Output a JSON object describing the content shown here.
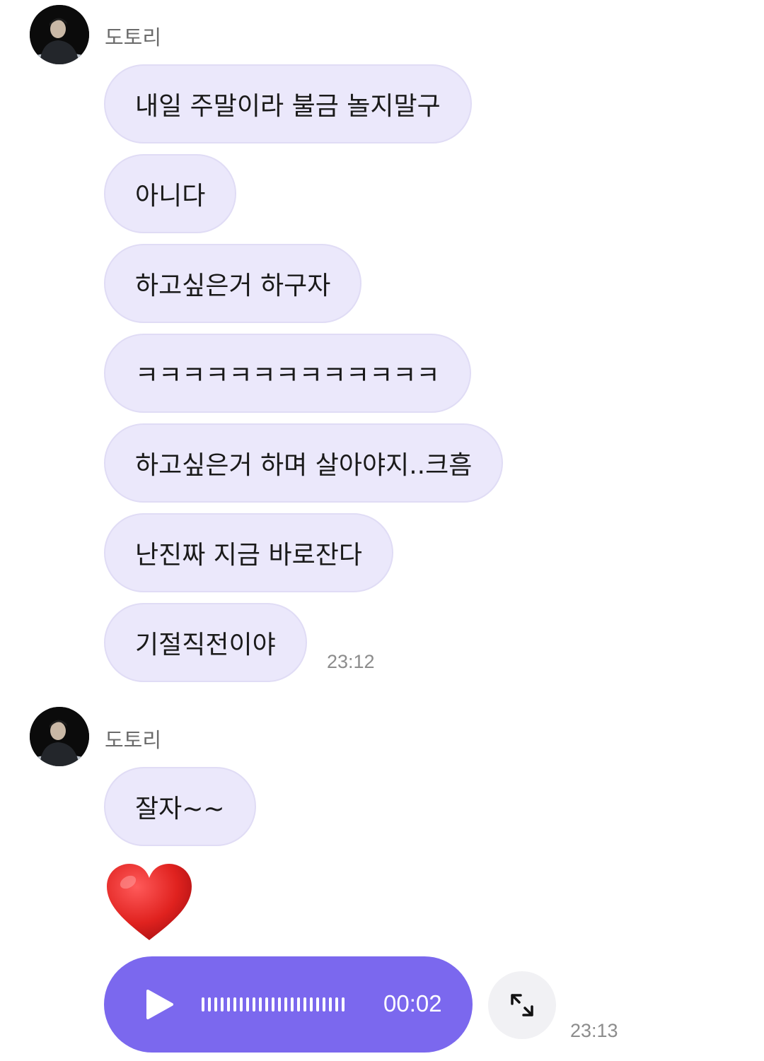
{
  "groups": [
    {
      "sender": "도토리",
      "messages": [
        "내일 주말이라 불금 놀지말구",
        "아니다",
        "하고싶은거 하구자",
        "ㅋㅋㅋㅋㅋㅋㅋㅋㅋㅋㅋㅋㅋ",
        "하고싶은거 하며 살아야지..크흠",
        "난진짜 지금 바로잔다",
        "기절직전이야"
      ],
      "time": "23:12"
    },
    {
      "sender": "도토리",
      "messages": [
        "잘자~~"
      ],
      "emoji": "heart",
      "voice": {
        "duration": "00:02"
      },
      "time": "23:13"
    }
  ],
  "colors": {
    "bubble": "#ebe8fb",
    "voice_bubble": "#7b68ee"
  },
  "icons": {
    "play": "play-icon",
    "expand": "expand-icon",
    "heart": "red-heart-emoji"
  }
}
